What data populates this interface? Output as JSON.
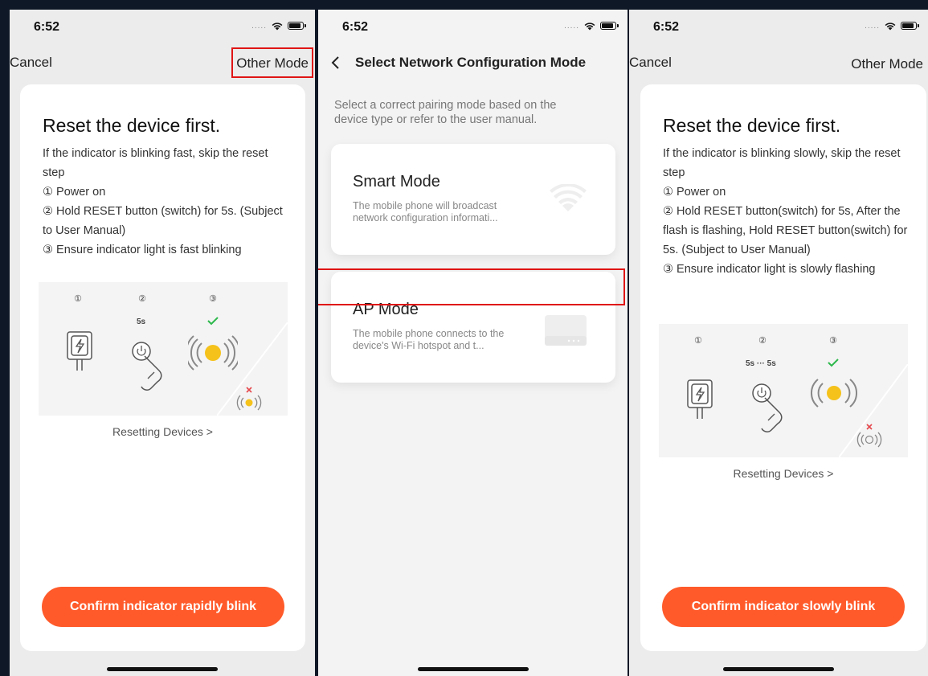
{
  "status": {
    "time": "6:52",
    "dots": "....."
  },
  "screen1": {
    "cancel": "Cancel",
    "other_mode": "Other Mode",
    "title": "Reset the device first.",
    "steps": [
      "If the indicator is blinking fast, skip the reset step",
      "① Power on",
      "② Hold RESET button (switch) for 5s. (Subject to User Manual)",
      "③ Ensure indicator light is fast blinking"
    ],
    "panel_nums": [
      "①",
      "②",
      "③"
    ],
    "hold_time": "5s",
    "resetting_link": "Resetting Devices >",
    "confirm": "Confirm indicator rapidly blink"
  },
  "screen2": {
    "title": "Select Network Configuration Mode",
    "hint": "Select a correct pairing mode based on the device type or refer to the user manual.",
    "modes": [
      {
        "title": "Smart Mode",
        "desc": "The mobile phone will broadcast network configuration informati...",
        "icon": "wifi-icon"
      },
      {
        "title": "AP Mode",
        "desc": "The mobile phone connects to the device's Wi-Fi hotspot and t...",
        "icon": "router-icon"
      }
    ]
  },
  "screen3": {
    "cancel": "Cancel",
    "other_mode": "Other Mode",
    "title": "Reset the device first.",
    "steps": [
      "If the indicator is blinking slowly, skip the reset step",
      "① Power on",
      "② Hold RESET button(switch) for 5s, After the flash is flashing, Hold RESET button(switch) for 5s. (Subject to User Manual)",
      "③ Ensure indicator light is slowly flashing"
    ],
    "panel_nums": [
      "①",
      "②",
      "③"
    ],
    "hold_time": "5s ··· 5s",
    "resetting_link": "Resetting Devices >",
    "confirm": "Confirm indicator slowly blink"
  },
  "colors": {
    "accent": "#ff5a2a",
    "highlight": "#e01515",
    "indicator": "#f5c21b",
    "check": "#2db84c",
    "cross": "#e5484d"
  }
}
